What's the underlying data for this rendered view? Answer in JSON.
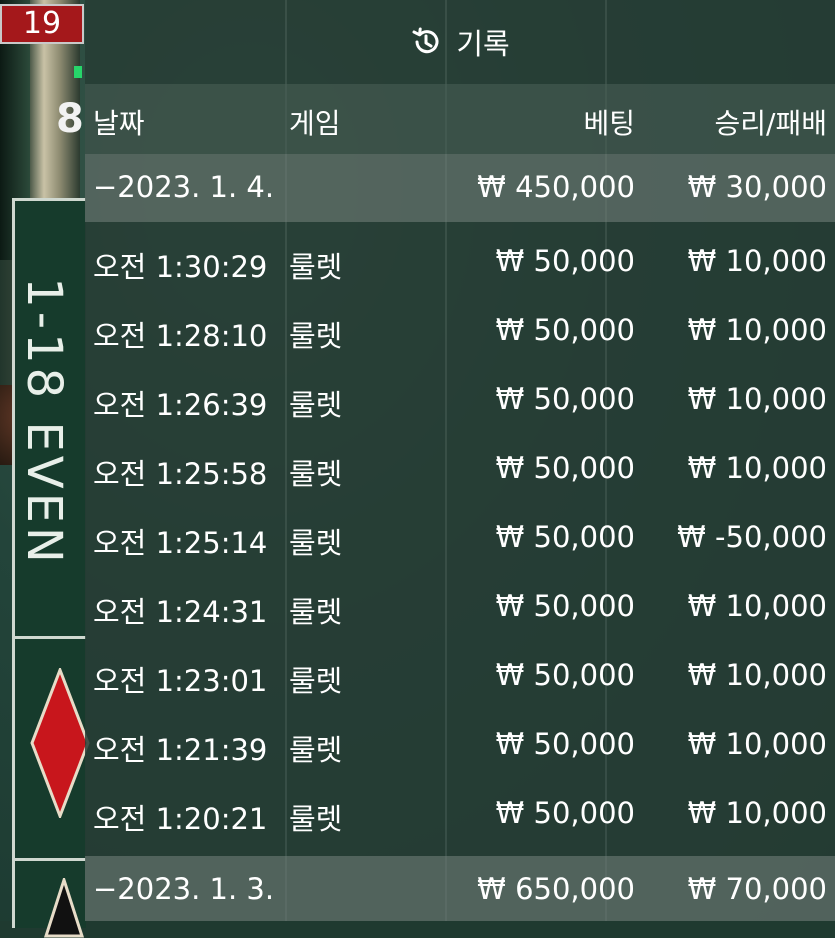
{
  "background": {
    "last_number": "19",
    "side_number": "8",
    "bet_area_label": "1-18 EVEN"
  },
  "panel": {
    "title": "기록",
    "title_icon": "history-icon",
    "columns": {
      "date": "날짜",
      "game": "게임",
      "bet": "베팅",
      "result": "승리/패배"
    },
    "groups": [
      {
        "date": "−2023. 1. 4.",
        "bet": "₩ 450,000",
        "result": "₩ 30,000",
        "rows": [
          {
            "time": "오전 1:30:29",
            "game": "룰렛",
            "bet": "₩ 50,000",
            "result": "₩ 10,000"
          },
          {
            "time": "오전 1:28:10",
            "game": "룰렛",
            "bet": "₩ 50,000",
            "result": "₩ 10,000"
          },
          {
            "time": "오전 1:26:39",
            "game": "룰렛",
            "bet": "₩ 50,000",
            "result": "₩ 10,000"
          },
          {
            "time": "오전 1:25:58",
            "game": "룰렛",
            "bet": "₩ 50,000",
            "result": "₩ 10,000"
          },
          {
            "time": "오전 1:25:14",
            "game": "룰렛",
            "bet": "₩ 50,000",
            "result": "₩ -50,000"
          },
          {
            "time": "오전 1:24:31",
            "game": "룰렛",
            "bet": "₩ 50,000",
            "result": "₩ 10,000"
          },
          {
            "time": "오전 1:23:01",
            "game": "룰렛",
            "bet": "₩ 50,000",
            "result": "₩ 10,000"
          },
          {
            "time": "오전 1:21:39",
            "game": "룰렛",
            "bet": "₩ 50,000",
            "result": "₩ 10,000"
          },
          {
            "time": "오전 1:20:21",
            "game": "룰렛",
            "bet": "₩ 50,000",
            "result": "₩ 10,000"
          }
        ]
      },
      {
        "date": "−2023. 1. 3.",
        "bet": "₩ 650,000",
        "result": "₩ 70,000",
        "rows": []
      }
    ]
  },
  "colors": {
    "last_number_bg": "#a4181b",
    "diamond_red": "#c8161c",
    "panel_bg": "#263c34"
  }
}
